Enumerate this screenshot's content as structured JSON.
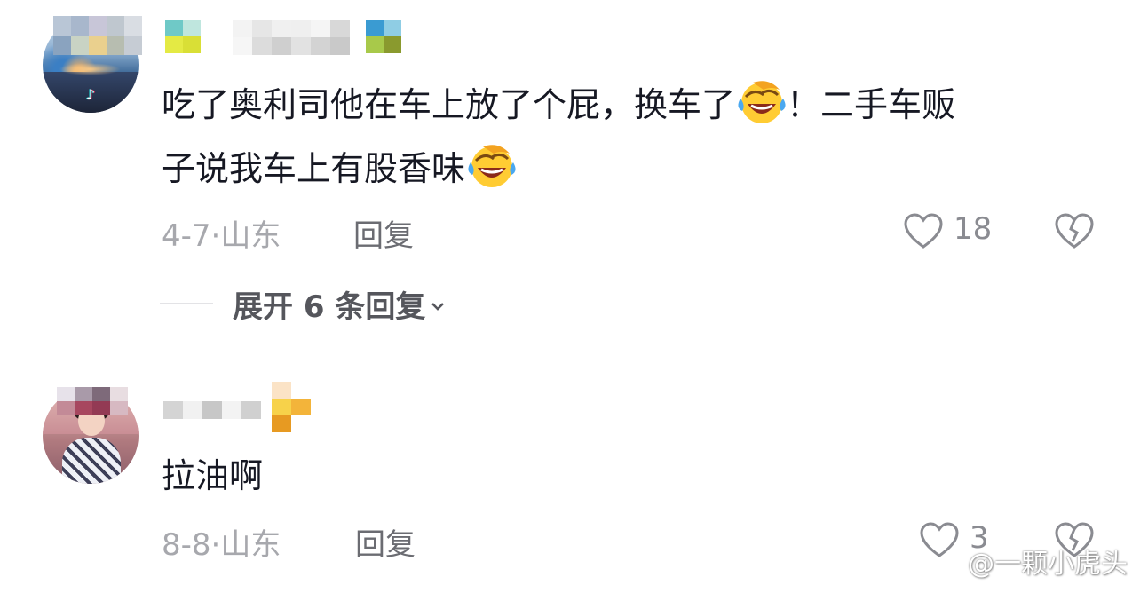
{
  "comments": [
    {
      "text_line1": "吃了奥利司他在车上放了个屁，换车了",
      "text_line1_tail": "！二手车贩",
      "text_line2": "子说我车上有股香味",
      "date": "4-7",
      "separator": "·",
      "location": "山东",
      "reply_label": "回复",
      "likes": "18"
    },
    {
      "text": "拉油啊",
      "date": "8-8",
      "separator": "·",
      "location": "山东",
      "reply_label": "回复",
      "likes": "3"
    }
  ],
  "expand_replies_label": "展开 6 条回复",
  "watermark": "@一颗小虎头",
  "icons": {
    "like": "heart-outline-icon",
    "dislike": "broken-heart-icon",
    "emoji": "laughing-tears-emoji",
    "expand": "chevron-down-icon",
    "watermark_logo": "weibo-icon"
  },
  "colors": {
    "text_primary": "#161823",
    "text_meta": "#a7a8ad",
    "reply": "#6b6c72"
  }
}
